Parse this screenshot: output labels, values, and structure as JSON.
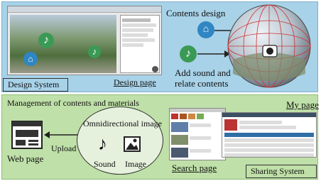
{
  "top": {
    "design_system": "Design System",
    "design_page": "Design page",
    "contents_design": "Contents design",
    "add_sound_line1": "Add sound and",
    "add_sound_line2": "relate contents"
  },
  "bottom": {
    "management": "Management of contents and materials",
    "omni": "Omnidirectional image",
    "sound": "Sound",
    "image": "Image",
    "upload": "Upload",
    "web_page": "Web page",
    "search_page": "Search page",
    "my_page": "My page",
    "sharing_system": "Sharing System"
  },
  "colors": {
    "top_bg": "#a8d2e8",
    "bottom_bg": "#bfe0a8",
    "music_icon": "#3a9a55",
    "location_icon": "#2f86c2"
  }
}
